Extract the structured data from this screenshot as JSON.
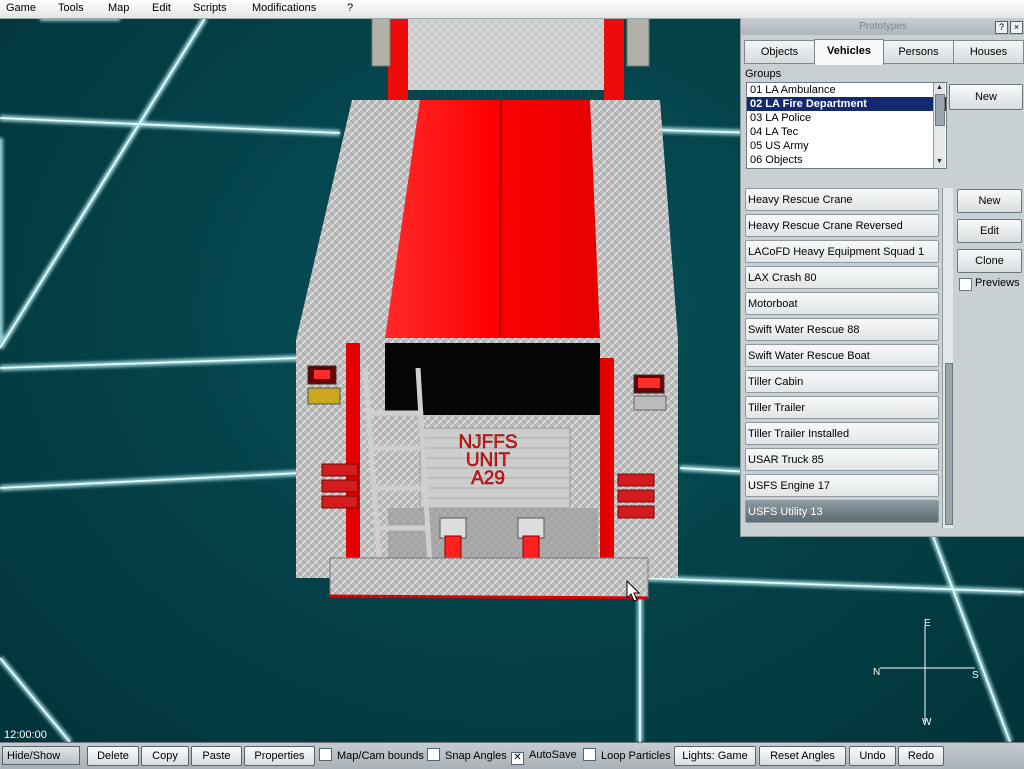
{
  "menu": [
    "Game",
    "Tools",
    "Map",
    "Edit",
    "Scripts",
    "Modifications",
    "?"
  ],
  "prototypes": {
    "title": "Prototypes",
    "help_icon": "?",
    "close_icon": "×",
    "tabs": [
      "Objects",
      "Vehicles",
      "Persons",
      "Houses"
    ],
    "active_tab": "Vehicles",
    "groups_label": "Groups",
    "groups": [
      "01 LA Ambulance",
      "02 LA Fire Department",
      "03 LA Police",
      "04 LA Tec",
      "05 US Army",
      "06 Objects"
    ],
    "selected_group": "02 LA Fire Department",
    "groups_new_button": "New",
    "vehicles": [
      "Heavy Rescue Crane",
      "Heavy Rescue Crane Reversed",
      "LACoFD Heavy Equipment Squad 1",
      "LAX Crash 80",
      "Motorboat",
      "Swift Water Rescue 88",
      "Swift Water Rescue Boat",
      "Tiller Cabin",
      "Tiller Trailer",
      "Tiller Trailer Installed",
      "USAR Truck 85",
      "USFS Engine 17",
      "USFS Utility 13"
    ],
    "selected_vehicle": "USFS Utility 13",
    "buttons": {
      "new": "New",
      "edit": "Edit",
      "clone": "Clone"
    },
    "previews_label": "Previews"
  },
  "vehicle_text": [
    "NJFFS",
    "UNIT",
    "A29"
  ],
  "compass": {
    "n": "N",
    "s": "S",
    "e": "E",
    "w": "W"
  },
  "clock": "12:00:00",
  "toolbar": {
    "hide_show": "Hide/Show",
    "delete": "Delete",
    "copy": "Copy",
    "paste": "Paste",
    "properties": "Properties",
    "map_cam_bounds": "Map/Cam bounds",
    "snap_angles": "Snap Angles",
    "autosave": "AutoSave",
    "autosave_checked": true,
    "loop_particles": "Loop Particles",
    "lights": "Lights: Game",
    "reset_angles": "Reset Angles",
    "undo": "Undo",
    "redo": "Redo"
  },
  "colors": {
    "selection": "#142a6e",
    "ground": "#053d42",
    "grid": "#a8dfe2",
    "truck_red": "#ff1a1a"
  }
}
